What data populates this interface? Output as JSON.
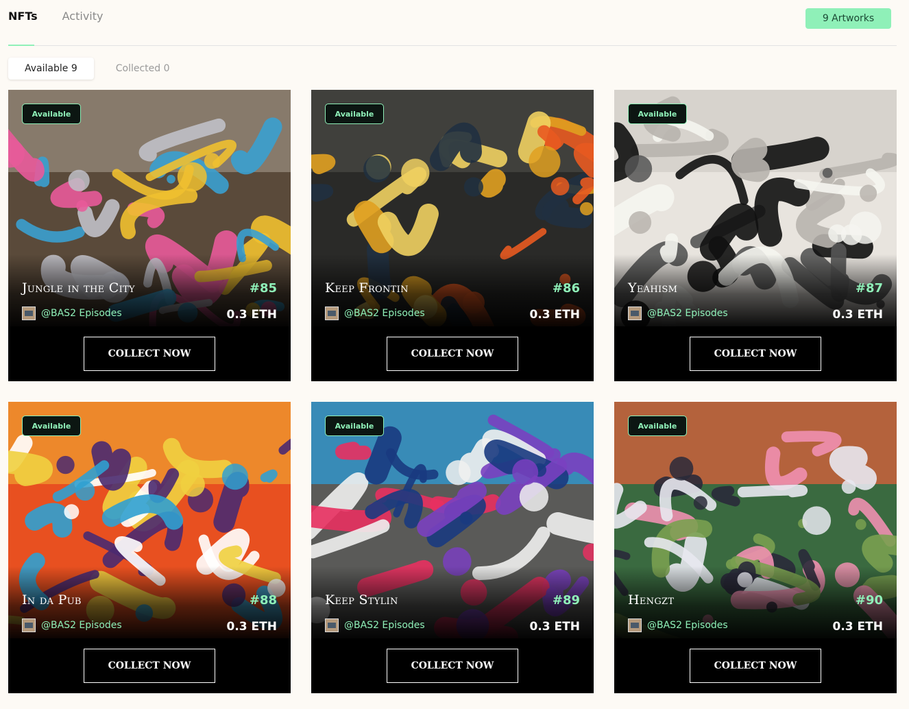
{
  "tabs": [
    {
      "label": "NFTs",
      "active": true
    },
    {
      "label": "Activity",
      "active": false
    }
  ],
  "artworks_badge": "9 Artworks",
  "filters": [
    {
      "label": "Available 9",
      "active": true
    },
    {
      "label": "Collected 0",
      "active": false
    }
  ],
  "colors": {
    "accent": "#8ff0b8",
    "page_bg": "#fdfaf5",
    "card_bg": "#000000"
  },
  "cards": [
    {
      "status": "Available",
      "title": "Jungle in the City",
      "token": "#85",
      "creator": "@BAS2 Episodes",
      "price": "0.3 ETH",
      "button": "COLLECT NOW",
      "palette": [
        "#5a4a3a",
        "#9a8f80",
        "#3aa0d0",
        "#e85a9a",
        "#f0c030",
        "#c0c0c8"
      ]
    },
    {
      "status": "Available",
      "title": "Keep Frontin",
      "token": "#86",
      "creator": "@BAS2 Episodes",
      "price": "0.3 ETH",
      "button": "COLLECT NOW",
      "palette": [
        "#2a2a28",
        "#4a4a44",
        "#e0a020",
        "#e85a20",
        "#f0d060",
        "#203040"
      ]
    },
    {
      "status": "Available",
      "title": "Yeahism",
      "token": "#87",
      "creator": "@BAS2 Episodes",
      "price": "0.3 ETH",
      "button": "COLLECT NOW",
      "palette": [
        "#e8e4de",
        "#d0ccc6",
        "#111111",
        "#f5f5f0",
        "#555555",
        "#b8b4ae"
      ]
    },
    {
      "status": "Available",
      "title": "In da Pub",
      "token": "#88",
      "creator": "@BAS2 Episodes",
      "price": "0.3 ETH",
      "button": "COLLECT NOW",
      "palette": [
        "#e85020",
        "#f0a030",
        "#f0d040",
        "#4a2a70",
        "#30a0d0",
        "#ffffff"
      ]
    },
    {
      "status": "Available",
      "title": "Keep Stylin",
      "token": "#89",
      "creator": "@BAS2 Episodes",
      "price": "0.3 ETH",
      "button": "COLLECT NOW",
      "palette": [
        "#5a5a58",
        "#2aa0e0",
        "#e83060",
        "#7a40c0",
        "#f0f0f0",
        "#1a3a80"
      ]
    },
    {
      "status": "Available",
      "title": "Hengzt",
      "token": "#90",
      "creator": "@BAS2 Episodes",
      "price": "0.3 ETH",
      "button": "COLLECT NOW",
      "palette": [
        "#3a6a40",
        "#e8603a",
        "#f090b0",
        "#e8e8f0",
        "#2a2a3a",
        "#7aa050"
      ]
    }
  ]
}
